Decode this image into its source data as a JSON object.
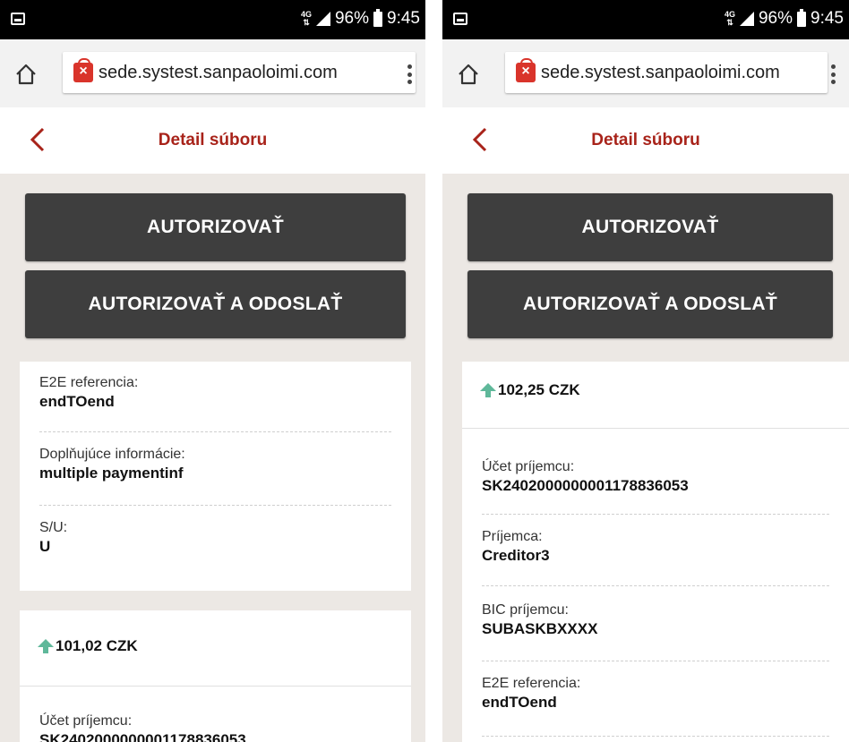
{
  "status_bar": {
    "network": "4G",
    "battery": "96%",
    "time": "9:45"
  },
  "browser": {
    "url": "sede.systest.sanpaoloimi.com"
  },
  "header": {
    "title": "Detail súboru"
  },
  "actions": {
    "authorize": "AUTORIZOVAŤ",
    "authorize_send": "AUTORIZOVAŤ A ODOSLAŤ"
  },
  "left": {
    "info": [
      {
        "label": "E2E referencia:",
        "value": "endTOend"
      },
      {
        "label": "Doplňujúce informácie:",
        "value": "multiple paymentinf"
      },
      {
        "label": "S/U:",
        "value": "U"
      }
    ],
    "payment": {
      "amount": "101,02 CZK",
      "fields": [
        {
          "label": "Účet príjemcu:",
          "value": "SK2402000000001178836053"
        }
      ]
    }
  },
  "right": {
    "payment": {
      "amount": "102,25 CZK",
      "fields": [
        {
          "label": "Účet príjemcu:",
          "value": "SK2402000000001178836053"
        },
        {
          "label": "Príjemca:",
          "value": "Creditor3"
        },
        {
          "label": "BIC príjemcu:",
          "value": "SUBASKBXXXX"
        },
        {
          "label": "E2E referencia:",
          "value": "endTOend"
        }
      ]
    }
  },
  "colors": {
    "accent": "#a8231a",
    "button": "#3e3e3e",
    "arrow_up": "#5fb89a",
    "background": "#ece8e4"
  }
}
